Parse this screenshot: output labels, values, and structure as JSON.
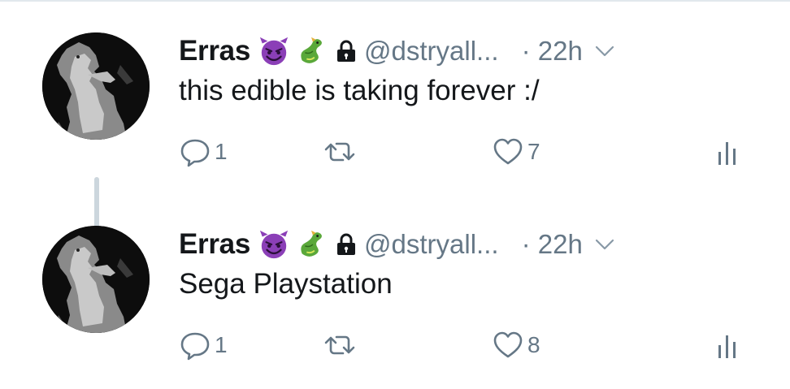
{
  "tweets": [
    {
      "name": "Erras",
      "handle": "@dstryall...",
      "time": "· 22h",
      "text": "this edible is taking forever :/",
      "reply_count": "1",
      "like_count": "7",
      "emojis": [
        "smiling-devil-icon",
        "dragon-icon"
      ],
      "locked": true
    },
    {
      "name": "Erras",
      "handle": "@dstryall...",
      "time": "· 22h",
      "text": "Sega Playstation",
      "reply_count": "1",
      "like_count": "8",
      "emojis": [
        "smiling-devil-icon",
        "dragon-icon"
      ],
      "locked": true
    }
  ],
  "colors": {
    "text": "#14171a",
    "secondary": "#657786",
    "thread_line": "#ccd6dd",
    "devil": "#8b3fb7"
  },
  "icons": {
    "reply": "reply-icon",
    "retweet": "retweet-icon",
    "like": "heart-icon",
    "stats": "analytics-icon",
    "lock": "lock-icon",
    "caret": "chevron-down-icon"
  }
}
